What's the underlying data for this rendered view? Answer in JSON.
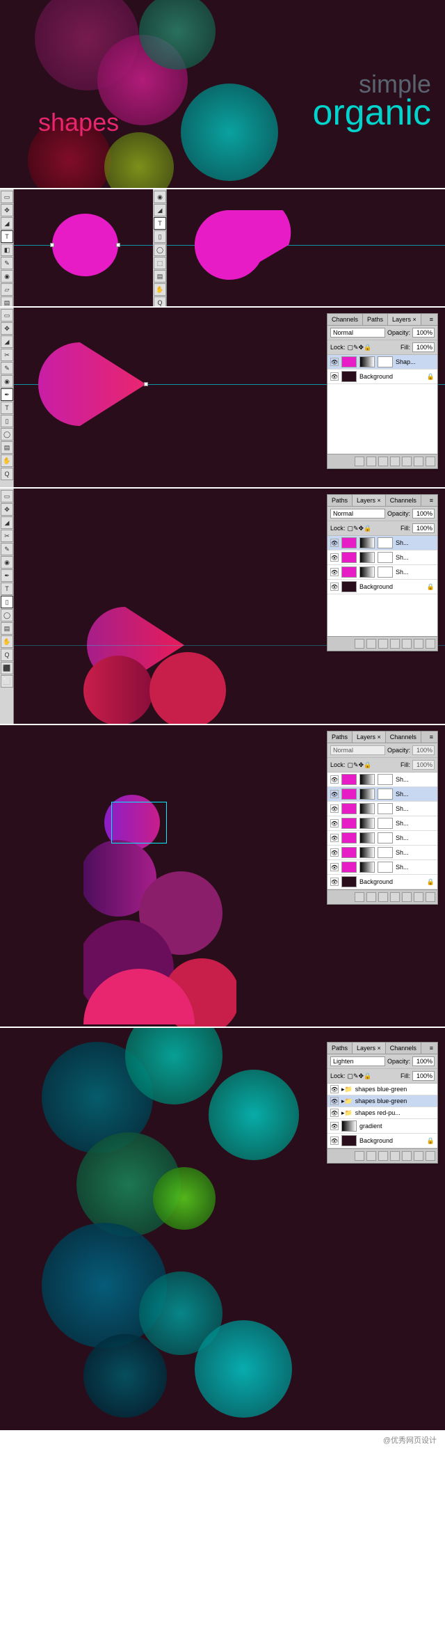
{
  "hero": {
    "simple": "simple",
    "organic": "organic",
    "shapes": "shapes"
  },
  "toolbar_icons": [
    "▭",
    "⬚",
    "✥",
    "✎",
    "T",
    "◢",
    "✂",
    "◉",
    "▤",
    "✦",
    "◐",
    "▱",
    "⬛",
    "⬜"
  ],
  "mini_icons": [
    "◉",
    "◢",
    "T",
    "▯",
    "◯",
    "⬚",
    "▤",
    "✋",
    "Q"
  ],
  "panel2": {
    "tabs": [
      "Channels",
      "Paths",
      "Layers ×"
    ],
    "blend": "Normal",
    "opacity_lbl": "Opacity:",
    "opacity": "100%",
    "lock_lbl": "Lock:",
    "fill_lbl": "Fill:",
    "fill": "100%",
    "layers": [
      {
        "name": "Shap...",
        "sel": true,
        "thumbs": [
          "magenta",
          "grad",
          "mask"
        ]
      },
      {
        "name": "Background",
        "sel": false,
        "thumbs": [
          "bg"
        ],
        "lock": true
      }
    ]
  },
  "panel3": {
    "tabs": [
      "Paths",
      "Layers ×",
      "Channels"
    ],
    "blend": "Normal",
    "opacity_lbl": "Opacity:",
    "opacity": "100%",
    "lock_lbl": "Lock:",
    "fill_lbl": "Fill:",
    "fill": "100%",
    "layers": [
      {
        "name": "Sh...",
        "sel": true,
        "thumbs": [
          "magenta",
          "grad",
          "mask"
        ]
      },
      {
        "name": "Sh...",
        "sel": false,
        "thumbs": [
          "magenta",
          "grad",
          "mask"
        ]
      },
      {
        "name": "Sh...",
        "sel": false,
        "thumbs": [
          "magenta",
          "grad",
          "mask"
        ]
      },
      {
        "name": "Background",
        "sel": false,
        "thumbs": [
          "bg"
        ],
        "lock": true
      }
    ]
  },
  "panel4": {
    "tabs": [
      "Paths",
      "Layers ×",
      "Channels"
    ],
    "blend": "Normal",
    "opacity_lbl": "Opacity:",
    "opacity": "100%",
    "lock_lbl": "Lock:",
    "fill_lbl": "Fill:",
    "fill": "100%",
    "layers": [
      {
        "name": "Sh...",
        "thumbs": [
          "magenta",
          "grad",
          "mask"
        ]
      },
      {
        "name": "Sh...",
        "sel": true,
        "thumbs": [
          "magenta",
          "grad",
          "mask"
        ]
      },
      {
        "name": "Sh...",
        "thumbs": [
          "magenta",
          "grad",
          "mask"
        ]
      },
      {
        "name": "Sh...",
        "thumbs": [
          "magenta",
          "grad",
          "mask"
        ]
      },
      {
        "name": "Sh...",
        "thumbs": [
          "magenta",
          "grad",
          "mask"
        ]
      },
      {
        "name": "Sh...",
        "thumbs": [
          "magenta",
          "grad",
          "mask"
        ]
      },
      {
        "name": "Sh...",
        "thumbs": [
          "magenta",
          "grad",
          "mask"
        ]
      },
      {
        "name": "Background",
        "thumbs": [
          "bg"
        ],
        "lock": true
      }
    ]
  },
  "panel5": {
    "tabs": [
      "Paths",
      "Layers ×",
      "Channels"
    ],
    "blend": "Lighten",
    "opacity_lbl": "Opacity:",
    "opacity": "100%",
    "lock_lbl": "Lock:",
    "fill_lbl": "Fill:",
    "fill": "100%",
    "layers": [
      {
        "name": "shapes blue-green",
        "folder": true
      },
      {
        "name": "shapes blue-green",
        "folder": true,
        "sel": true
      },
      {
        "name": "shapes red-pu...",
        "folder": true
      },
      {
        "name": "gradient",
        "thumbs": [
          "grad"
        ]
      },
      {
        "name": "Background",
        "thumbs": [
          "bg"
        ],
        "lock": true
      }
    ]
  },
  "footer": "@优秀网页设计"
}
